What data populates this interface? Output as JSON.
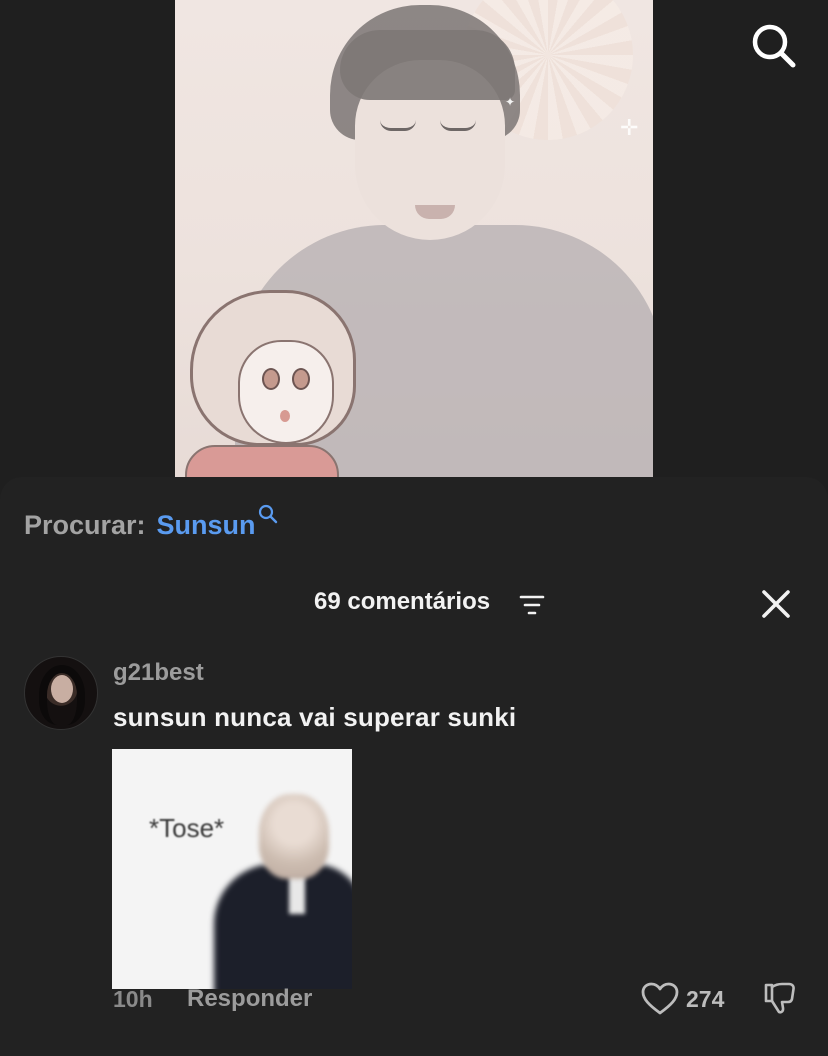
{
  "search": {
    "prefix": "Procurar:",
    "term": "Sunsun"
  },
  "comments_header": {
    "count_label": "69 comentários"
  },
  "comment": {
    "username": "g21best",
    "text": "sunsun nunca vai superar sunki",
    "image_caption": "*Tose*",
    "time": "10h",
    "reply_label": "Responder",
    "likes": "274"
  },
  "colors": {
    "background": "#1f1f1f",
    "sheet": "#222222",
    "accent_link": "#5a9bf0",
    "primary_text": "#f2f2f2",
    "secondary_text": "#9c9c9c"
  },
  "icons": {
    "top_right": "search-icon",
    "inline_search": "search-icon",
    "sort": "filter-icon",
    "close": "close-icon",
    "like": "heart-icon",
    "dislike": "thumbs-down-icon"
  }
}
